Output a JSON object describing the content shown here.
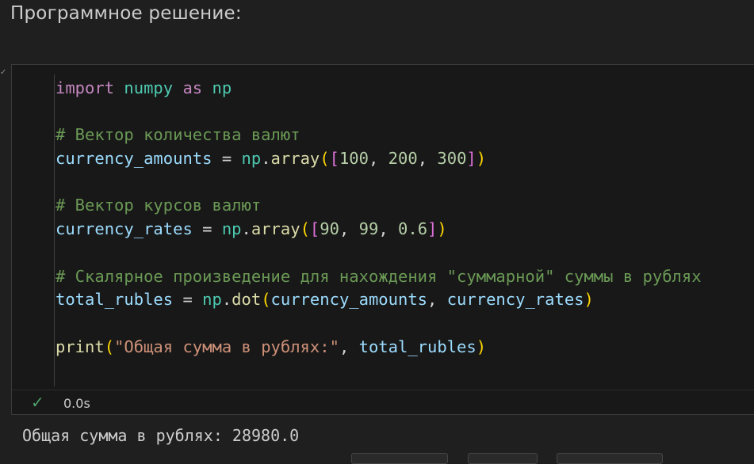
{
  "heading": "Программное решение:",
  "code": {
    "line1": {
      "kw1": "import",
      "mod": "numpy",
      "kw2": "as",
      "alias": "np"
    },
    "line3": {
      "comment": "# Вектор количества валют"
    },
    "line4": {
      "var": "currency_amounts",
      "eq": " = ",
      "mod": "np",
      "dot": ".",
      "fn": "array",
      "open1": "(",
      "open2": "[",
      "n1": "100",
      "sep1": ", ",
      "n2": "200",
      "sep2": ", ",
      "n3": "300",
      "close2": "]",
      "close1": ")"
    },
    "line6": {
      "comment": "# Вектор курсов валют"
    },
    "line7": {
      "var": "currency_rates",
      "eq": " = ",
      "mod": "np",
      "dot": ".",
      "fn": "array",
      "open1": "(",
      "open2": "[",
      "n1": "90",
      "sep1": ", ",
      "n2": "99",
      "sep2": ", ",
      "n3": "0.6",
      "close2": "]",
      "close1": ")"
    },
    "line9": {
      "comment": "# Скалярное произведение для нахождения \"суммарной\" суммы в рублях"
    },
    "line10": {
      "var": "total_rubles",
      "eq": " = ",
      "mod": "np",
      "dot": ".",
      "fn": "dot",
      "open1": "(",
      "arg1": "currency_amounts",
      "sep1": ", ",
      "arg2": "currency_rates",
      "close1": ")"
    },
    "line12": {
      "fn": "print",
      "open1": "(",
      "str": "\"Общая сумма в рублях:\"",
      "sep1": ", ",
      "arg": "total_rubles",
      "close1": ")"
    }
  },
  "status": {
    "check_icon": "✓",
    "time": "0.0s"
  },
  "output": "Общая сумма в рублях: 28980.0"
}
